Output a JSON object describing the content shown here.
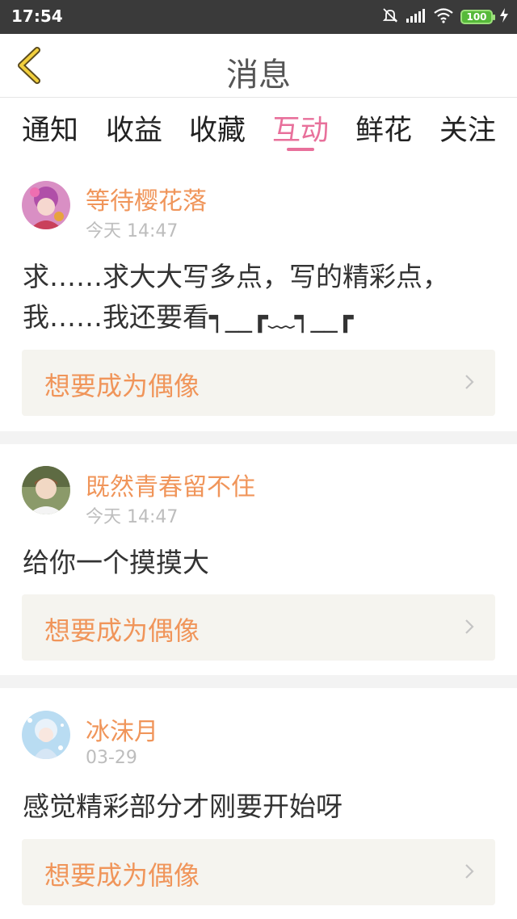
{
  "status_bar": {
    "time": "17:54",
    "battery": "100"
  },
  "header": {
    "title": "消息"
  },
  "tabs": [
    {
      "label": "通知"
    },
    {
      "label": "收益"
    },
    {
      "label": "收藏"
    },
    {
      "label": "互动",
      "active": true
    },
    {
      "label": "鲜花"
    },
    {
      "label": "关注"
    }
  ],
  "messages": [
    {
      "username": "等待樱花落",
      "time": "今天 14:47",
      "content_line1": "求……求大大写多点，写的精彩点，",
      "content_line2": "我……我还要看┑__┏﹏┑__┏",
      "action_label": "想要成为偶像"
    },
    {
      "username": "既然青春留不住",
      "time": "今天 14:47",
      "content_line1": "给你一个摸摸大",
      "action_label": "想要成为偶像"
    },
    {
      "username": "冰沫月",
      "time": "03-29",
      "content_line1": "感觉精彩部分才刚要开始呀",
      "action_label": "想要成为偶像"
    }
  ],
  "colors": {
    "accent_pink": "#e8709b",
    "accent_orange": "#f0955a",
    "card_bg": "#f5f4ef"
  }
}
